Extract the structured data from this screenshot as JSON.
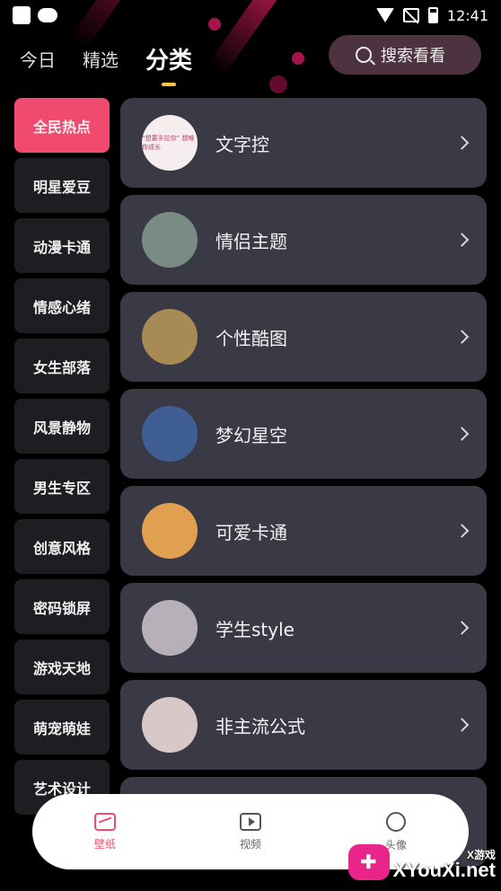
{
  "status_bar": {
    "time": "12:41"
  },
  "top_nav": {
    "tabs": [
      {
        "label": "今日"
      },
      {
        "label": "精选"
      },
      {
        "label": "分类",
        "active": true
      }
    ],
    "search_label": "搜索看看"
  },
  "sidebar": {
    "items": [
      {
        "label": "全民热点",
        "active": true
      },
      {
        "label": "明星爱豆"
      },
      {
        "label": "动漫卡通"
      },
      {
        "label": "情感心绪"
      },
      {
        "label": "女生部落"
      },
      {
        "label": "风景静物"
      },
      {
        "label": "男生专区"
      },
      {
        "label": "创意风格"
      },
      {
        "label": "密码锁屏"
      },
      {
        "label": "游戏天地"
      },
      {
        "label": "萌宠萌娃"
      },
      {
        "label": "艺术设计"
      }
    ]
  },
  "categories": [
    {
      "label": "文字控",
      "thumb_text": "“想要手拉你” 想唯你成长",
      "thumb_color": "#f6eeee"
    },
    {
      "label": "情侣主题",
      "thumb_color": "#7a8a84"
    },
    {
      "label": "个性酷图",
      "thumb_color": "#a88a55"
    },
    {
      "label": "梦幻星空",
      "thumb_color": "#3f5f94"
    },
    {
      "label": "可爱卡通",
      "thumb_color": "#e0a050"
    },
    {
      "label": "学生style",
      "thumb_color": "#b8b0b8"
    },
    {
      "label": "非主流公式",
      "thumb_color": "#d8c8c8"
    }
  ],
  "bottom_nav": {
    "items": [
      {
        "label": "壁纸",
        "icon": "wallpaper-icon",
        "active": true
      },
      {
        "label": "视频",
        "icon": "video-icon"
      },
      {
        "label": "头像",
        "icon": "face-icon"
      }
    ]
  },
  "watermark": {
    "small": "X游戏",
    "main": "XYouXi.net"
  },
  "colors": {
    "accent": "#f04b6e",
    "card": "#3a3a46",
    "tab_underline": "#f5c542"
  }
}
